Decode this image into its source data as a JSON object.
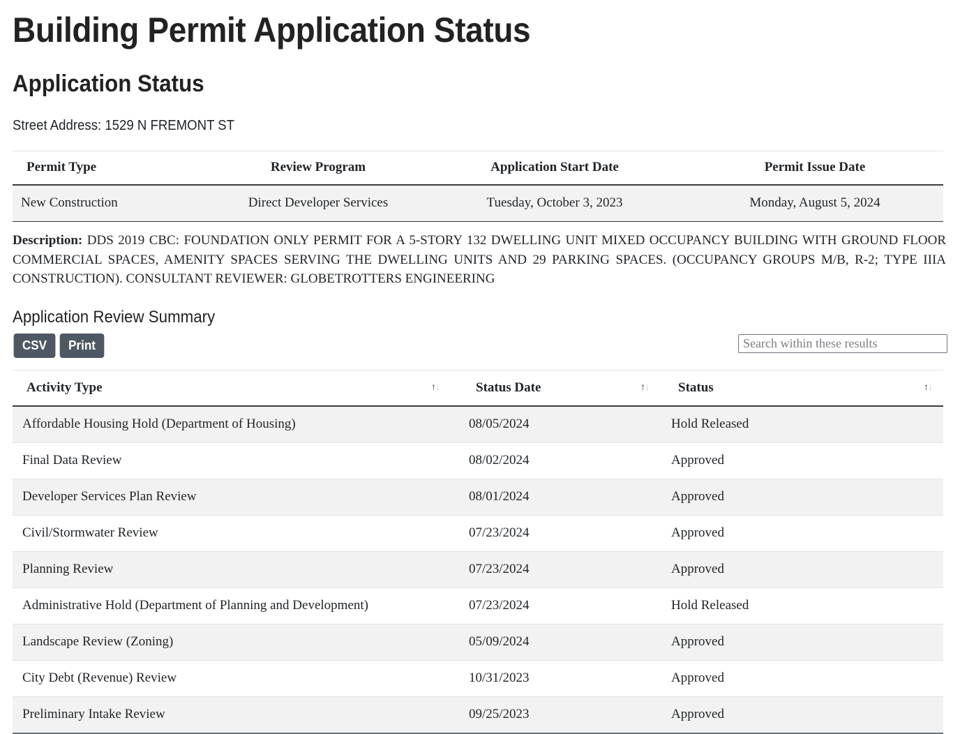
{
  "page": {
    "title": "Building Permit Application Status",
    "section_title": "Application Status",
    "street_address": "Street Address: 1529 N FREMONT ST",
    "review_summary_title": "Application Review Summary"
  },
  "permit_table": {
    "headers": [
      "Permit Type",
      "Review Program",
      "Application Start Date",
      "Permit Issue Date"
    ],
    "row": {
      "permit_type": "New Construction",
      "review_program": "Direct Developer Services",
      "application_start_date": "Tuesday, October 3, 2023",
      "permit_issue_date": "Monday, August 5, 2024"
    }
  },
  "description": {
    "label": "Description:",
    "text": "DDS 2019 CBC: FOUNDATION ONLY PERMIT FOR A 5-STORY 132 DWELLING UNIT MIXED OCCUPANCY BUILDING WITH GROUND FLOOR COMMERCIAL SPACES, AMENITY SPACES SERVING THE DWELLING UNITS AND 29 PARKING SPACES. (OCCUPANCY GROUPS M/B, R-2; TYPE IIIA CONSTRUCTION). CONSULTANT REVIEWER: GLOBETROTTERS ENGINEERING"
  },
  "toolbar": {
    "csv_label": "CSV",
    "print_label": "Print",
    "search_placeholder": "Search within these results",
    "search_value": ""
  },
  "review_table": {
    "headers": {
      "activity_type": "Activity Type",
      "status_date": "Status Date",
      "status": "Status"
    },
    "sort_arrow_up": "↑",
    "sort_arrow_down": "↓",
    "rows": [
      {
        "activity_type": "Affordable Housing Hold (Department of Housing)",
        "status_date": "08/05/2024",
        "status": "Hold Released"
      },
      {
        "activity_type": "Final Data Review",
        "status_date": "08/02/2024",
        "status": "Approved"
      },
      {
        "activity_type": "Developer Services Plan Review",
        "status_date": "08/01/2024",
        "status": "Approved"
      },
      {
        "activity_type": "Civil/Stormwater Review",
        "status_date": "07/23/2024",
        "status": "Approved"
      },
      {
        "activity_type": "Planning Review",
        "status_date": "07/23/2024",
        "status": "Approved"
      },
      {
        "activity_type": "Administrative Hold (Department of Planning and Development)",
        "status_date": "07/23/2024",
        "status": "Hold Released"
      },
      {
        "activity_type": "Landscape Review (Zoning)",
        "status_date": "05/09/2024",
        "status": "Approved"
      },
      {
        "activity_type": "City Debt (Revenue) Review",
        "status_date": "10/31/2023",
        "status": "Approved"
      },
      {
        "activity_type": "Preliminary Intake Review",
        "status_date": "09/25/2023",
        "status": "Approved"
      }
    ]
  },
  "colors": {
    "button_bg": "#4e5862",
    "row_stripe": "#f2f2f2",
    "row_border": "#dfe3e6",
    "header_border": "#3b3b3b"
  }
}
